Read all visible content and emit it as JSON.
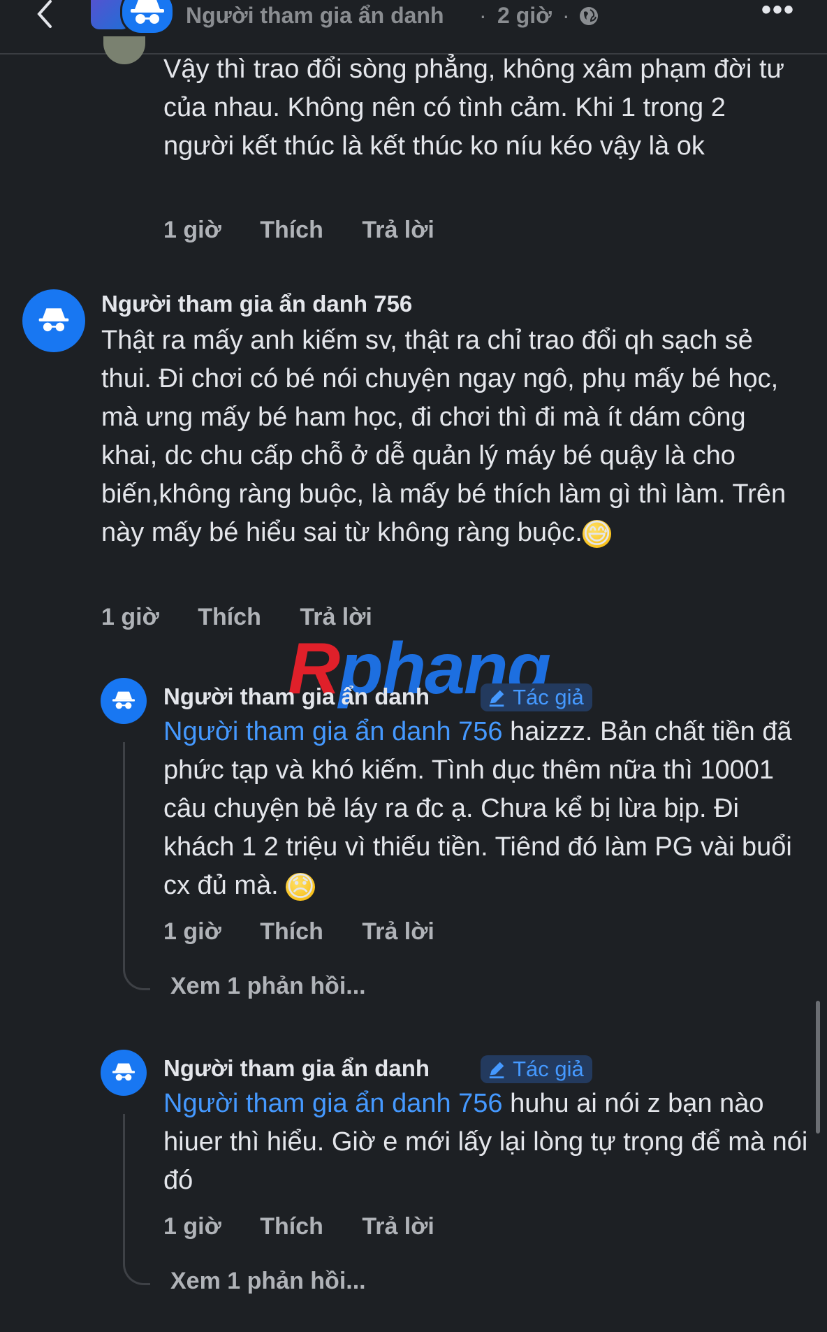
{
  "header": {
    "post_author": "Người tham gia ẩn danh",
    "separator": "·",
    "time": "2 giờ",
    "separator2": "·",
    "more_label": "•••"
  },
  "comments": [
    {
      "text": "Vậy thì trao đổi sòng phẳng, không xâm phạm đời tư của nhau. Không nên có tình cảm. Khi 1 trong 2 người kết thúc là kết thúc ko níu kéo vậy là ok",
      "time": "1 giờ",
      "like": "Thích",
      "reply": "Trả lời"
    },
    {
      "name": "Người tham gia ẩn danh 756",
      "text": "Thật ra mấy anh kiếm sv, thật ra chỉ trao đổi qh sạch sẻ thui. Đi chơi có bé nói chuyện ngay ngô, phụ mấy bé học, mà ưng mấy bé ham học, đi chơi thì đi mà ít dám công khai, dc chu cấp chỗ ở dễ quản lý máy bé quậy là cho biến,không ràng buộc, là mấy bé thích làm gì thì làm. Trên này mấy bé hiểu sai từ không ràng buộc.",
      "emoji": "😅",
      "time": "1 giờ",
      "like": "Thích",
      "reply": "Trả lời"
    }
  ],
  "replies": [
    {
      "name": "Người tham gia ẩn danh",
      "badge": "Tác giả",
      "mention": "Người tham gia ẩn danh 756",
      "text": " haizzz. Bản chất tiền đã phức tạp và khó kiếm. Tình dục thêm nữa thì 10001 câu chuyện bẻ láy ra đc ạ. Chưa kể bị lừa bịp. Đi khách 1 2 triệu vì thiếu tiền. Tiênd đó làm PG vài buổi cx đủ mà.",
      "emoji": "😞",
      "time": "1 giờ",
      "like": "Thích",
      "reply": "Trả lời",
      "more_replies": "Xem 1 phản hồi..."
    },
    {
      "name": "Người tham gia ẩn danh",
      "badge": "Tác giả",
      "mention": "Người tham gia ẩn danh 756",
      "text": " huhu ai nói z bạn nào hiuer thì hiểu. Giờ e mới lấy lại lòng tự trọng để mà nói đó",
      "time": "1 giờ",
      "like": "Thích",
      "reply": "Trả lời",
      "more_replies": "Xem 1 phản hồi..."
    }
  ],
  "watermark": {
    "first": "R",
    "rest": "phang"
  },
  "colors": {
    "background": "#1d2024",
    "text": "#e4e6eb",
    "secondary": "#b0b3b8",
    "accent": "#4599ff",
    "avatar": "#1877f2"
  },
  "icons": {
    "back": "chevron-left-icon",
    "globe": "globe-icon",
    "incognito": "incognito-icon",
    "pencil": "pencil-icon"
  }
}
